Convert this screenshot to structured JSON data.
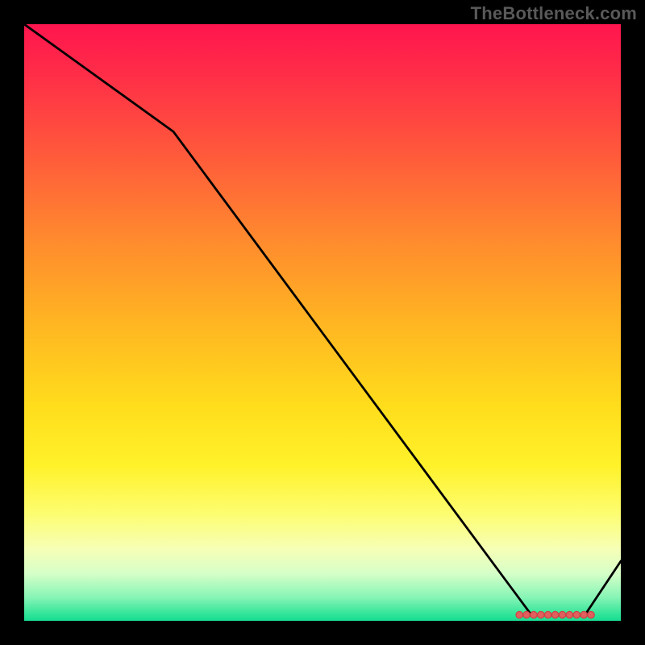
{
  "watermark": "TheBottleneck.com",
  "colors": {
    "background": "#000000",
    "line": "#000000",
    "marker_stroke": "#d04040",
    "marker_fill": "#e06060",
    "gradient_top": "#ff154e",
    "gradient_bottom": "#17dc92",
    "watermark_text": "#595959"
  },
  "chart_data": {
    "type": "line",
    "title": "",
    "xlabel": "",
    "ylabel": "",
    "xlim": [
      0,
      100
    ],
    "ylim": [
      0,
      100
    ],
    "x": [
      0,
      25,
      85,
      94,
      100
    ],
    "values": [
      100,
      82,
      1,
      1,
      10
    ],
    "markers": {
      "x": [
        83,
        84.2,
        85.4,
        86.6,
        87.8,
        89,
        90.2,
        91.4,
        92.6,
        93.8,
        95
      ],
      "y": [
        1.0,
        1.0,
        1.0,
        1.0,
        1.0,
        1.0,
        1.0,
        1.0,
        1.0,
        1.0,
        1.0
      ]
    }
  }
}
